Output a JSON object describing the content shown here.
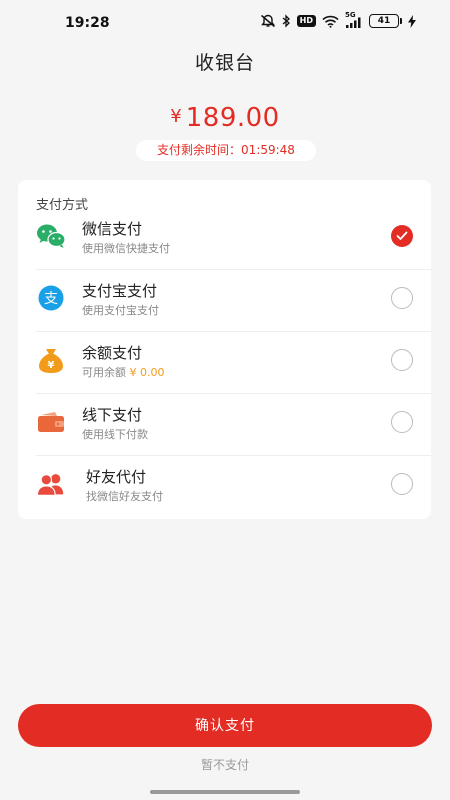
{
  "status_bar": {
    "time": "19:28",
    "hd": "HD",
    "network": "5G",
    "battery": "41"
  },
  "header": {
    "title": "收银台"
  },
  "amount": {
    "currency": "¥",
    "value": "189.00"
  },
  "timer": {
    "label": "支付剩余时间：01:59:48"
  },
  "card": {
    "title": "支付方式",
    "methods": [
      {
        "name": "微信支付",
        "desc": "使用微信快捷支付",
        "icon": "wechat-icon",
        "selected": true
      },
      {
        "name": "支付宝支付",
        "desc": "使用支付宝支付",
        "icon": "alipay-icon",
        "selected": false
      },
      {
        "name": "余额支付",
        "desc": "可用余额",
        "balance": "¥ 0.00",
        "icon": "money-bag-icon",
        "selected": false
      },
      {
        "name": "线下支付",
        "desc": "使用线下付款",
        "icon": "wallet-icon",
        "selected": false
      },
      {
        "name": "好友代付",
        "desc": "找微信好友支付",
        "icon": "friends-icon",
        "selected": false
      }
    ]
  },
  "footer": {
    "confirm": "确认支付",
    "cancel": "暂不支付"
  },
  "colors": {
    "accent": "#e32d24",
    "background": "#f5f5f5",
    "wechat": "#2aae67",
    "alipay": "#1aa0e8",
    "balance": "#f29b1a",
    "wallet": "#e8673b",
    "friends": "#e84a3d"
  }
}
